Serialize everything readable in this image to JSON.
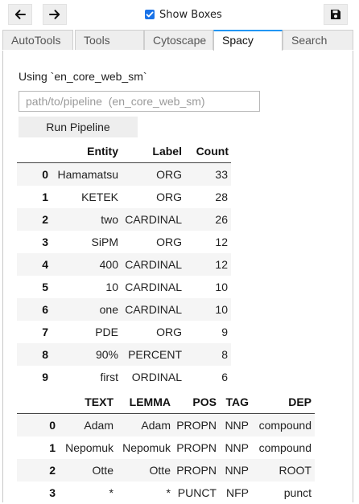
{
  "toolbar": {
    "back_icon": "arrow-left-icon",
    "forward_icon": "arrow-right-icon",
    "save_icon": "save-icon",
    "show_boxes_label": "Show Boxes",
    "show_boxes_checked": true,
    "accent": "#1a73e8"
  },
  "tabs": [
    {
      "label": "AutoTools"
    },
    {
      "label": "Tools"
    },
    {
      "label": "Cytoscape"
    },
    {
      "label": "Spacy"
    },
    {
      "label": "Search"
    }
  ],
  "active_tab": "Spacy",
  "spacy": {
    "using_text": "Using `en_core_web_sm`",
    "pipeline_placeholder": "path/to/pipeline  (en_core_web_sm)",
    "run_label": "Run Pipeline"
  },
  "entities": {
    "columns": [
      "Entity",
      "Label",
      "Count"
    ],
    "rows": [
      {
        "index": "0",
        "entity": "Hamamatsu",
        "label": "ORG",
        "count": "33"
      },
      {
        "index": "1",
        "entity": "KETEK",
        "label": "ORG",
        "count": "28"
      },
      {
        "index": "2",
        "entity": "two",
        "label": "CARDINAL",
        "count": "26"
      },
      {
        "index": "3",
        "entity": "SiPM",
        "label": "ORG",
        "count": "12"
      },
      {
        "index": "4",
        "entity": "400",
        "label": "CARDINAL",
        "count": "12"
      },
      {
        "index": "5",
        "entity": "10",
        "label": "CARDINAL",
        "count": "10"
      },
      {
        "index": "6",
        "entity": "one",
        "label": "CARDINAL",
        "count": "10"
      },
      {
        "index": "7",
        "entity": "PDE",
        "label": "ORG",
        "count": "9"
      },
      {
        "index": "8",
        "entity": "90%",
        "label": "PERCENT",
        "count": "8"
      },
      {
        "index": "9",
        "entity": "first",
        "label": "ORDINAL",
        "count": "6"
      }
    ]
  },
  "tokens": {
    "columns": [
      "TEXT",
      "LEMMA",
      "POS",
      "TAG",
      "DEP"
    ],
    "rows": [
      {
        "index": "0",
        "text": "Adam",
        "lemma": "Adam",
        "pos": "PROPN",
        "tag": "NNP",
        "dep": "compound"
      },
      {
        "index": "1",
        "text": "Nepomuk",
        "lemma": "Nepomuk",
        "pos": "PROPN",
        "tag": "NNP",
        "dep": "compound"
      },
      {
        "index": "2",
        "text": "Otte",
        "lemma": "Otte",
        "pos": "PROPN",
        "tag": "NNP",
        "dep": "ROOT"
      },
      {
        "index": "3",
        "text": "*",
        "lemma": "*",
        "pos": "PUNCT",
        "tag": "NFP",
        "dep": "punct"
      }
    ]
  }
}
